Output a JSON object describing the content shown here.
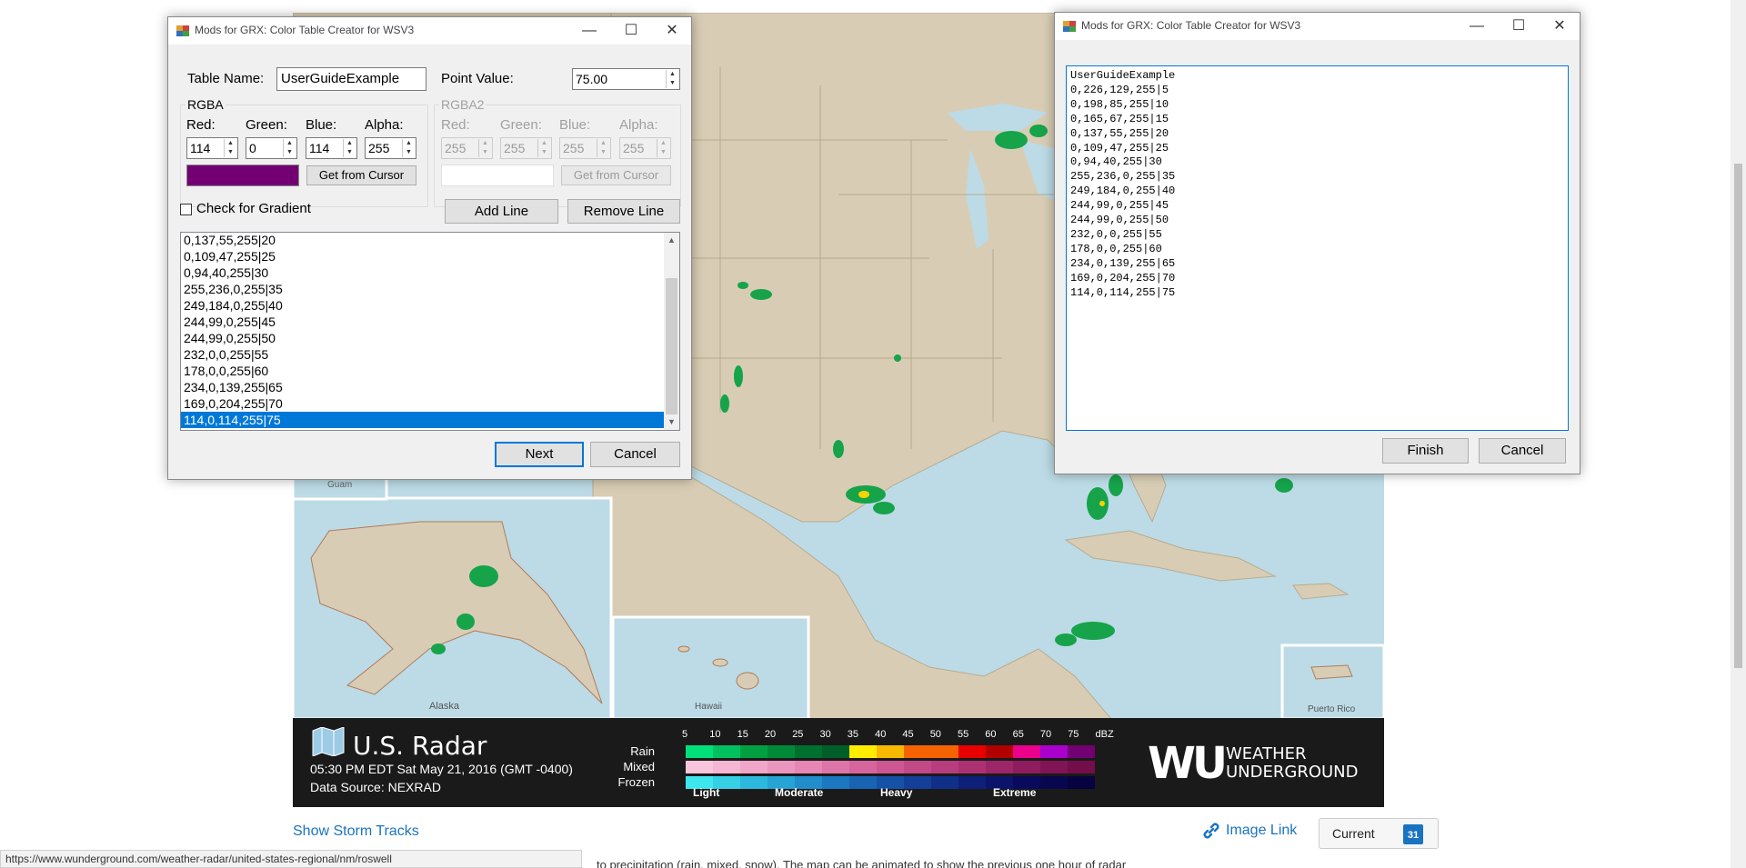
{
  "webpage": {
    "map_labels": {
      "guam": "Guam",
      "alaska": "Alaska",
      "hawaii": "Hawaii",
      "puerto_rico": "Puerto Rico"
    },
    "legend": {
      "title": "U.S. Radar",
      "timestamp": "05:30 PM EDT Sat May 21, 2016 (GMT -0400)",
      "source": "Data Source: NEXRAD",
      "scale_values": [
        "5",
        "10",
        "15",
        "20",
        "25",
        "30",
        "35",
        "40",
        "45",
        "50",
        "55",
        "60",
        "65",
        "70",
        "75",
        "dBZ"
      ],
      "rows": [
        "Rain",
        "Mixed",
        "Frozen"
      ],
      "intensity": [
        "Light",
        "Moderate",
        "Heavy",
        "Extreme"
      ],
      "rain_colors": [
        "#00e07a",
        "#00c060",
        "#00a040",
        "#008a37",
        "#006f2f",
        "#005e28",
        "#ffec00",
        "#f9b800",
        "#f46300",
        "#f46300",
        "#e80000",
        "#b20000",
        "#ea008b",
        "#a900cc",
        "#720072"
      ],
      "mixed_colors": [
        "#f7c6dc",
        "#f4b6d2",
        "#f0a6c8",
        "#eb96be",
        "#e586b4",
        "#de75a9",
        "#d6659e",
        "#cd5693",
        "#c24988",
        "#b73d7e",
        "#ab3173",
        "#9d2669",
        "#8f1c5e",
        "#801454",
        "#730d4b"
      ],
      "frozen_colors": [
        "#3ee6ee",
        "#35cfe6",
        "#2db8dd",
        "#27a3d4",
        "#218dca",
        "#1c78c0",
        "#1864b3",
        "#1551a6",
        "#133f98",
        "#102f89",
        "#0e207a",
        "#0b136a",
        "#0a0a5c",
        "#08064e",
        "#060340"
      ],
      "brand_mark": "WU",
      "brand_line1": "WEATHER",
      "brand_line2": "UNDERGROUND"
    },
    "show_storm_tracks": "Show Storm Tracks",
    "image_link": "Image Link",
    "current_button": "Current",
    "calendar_day": "31",
    "status_url": "https://www.wunderground.com/weather-radar/united-states-regional/nm/roswell",
    "body_text": "to precipitation (rain, mixed, snow). The map can be animated to show the previous one hour of radar"
  },
  "dialog_left": {
    "title": "Mods for GRX: Color Table Creator for WSV3",
    "table_name_label": "Table Name:",
    "table_name_value": "UserGuideExample",
    "point_value_label": "Point Value:",
    "point_value": "75.00",
    "rgba_group": "RGBA",
    "rgba2_group": "RGBA2",
    "red_label": "Red:",
    "green_label": "Green:",
    "blue_label": "Blue:",
    "alpha_label": "Alpha:",
    "red_value": "114",
    "green_value": "0",
    "blue_value": "114",
    "alpha_value": "255",
    "red2_value": "255",
    "green2_value": "255",
    "blue2_value": "255",
    "alpha2_value": "255",
    "swatch_color": "#720072",
    "get_from_cursor": "Get from Cursor",
    "check_gradient": "Check for Gradient",
    "add_line": "Add Line",
    "remove_line": "Remove Line",
    "list_items": [
      "0,137,55,255|20",
      "0,109,47,255|25",
      "0,94,40,255|30",
      "255,236,0,255|35",
      "249,184,0,255|40",
      "244,99,0,255|45",
      "244,99,0,255|50",
      "232,0,0,255|55",
      "178,0,0,255|60",
      "234,0,139,255|65",
      "169,0,204,255|70",
      "114,0,114,255|75"
    ],
    "next": "Next",
    "cancel": "Cancel"
  },
  "dialog_right": {
    "title": "Mods for GRX: Color Table Creator for WSV3",
    "output_text": "UserGuideExample\n0,226,129,255|5\n0,198,85,255|10\n0,165,67,255|15\n0,137,55,255|20\n0,109,47,255|25\n0,94,40,255|30\n255,236,0,255|35\n249,184,0,255|40\n244,99,0,255|45\n244,99,0,255|50\n232,0,0,255|55\n178,0,0,255|60\n234,0,139,255|65\n169,0,204,255|70\n114,0,114,255|75",
    "finish": "Finish",
    "cancel": "Cancel"
  }
}
